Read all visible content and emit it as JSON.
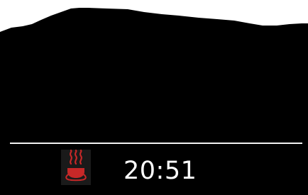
{
  "status_bar": {
    "icon": "steam-cup-icon",
    "icon_color": "#c62828",
    "time": "20:51"
  },
  "colors": {
    "display_background": "#000000",
    "divider": "#f2f2f2",
    "text": "#ffffff"
  }
}
